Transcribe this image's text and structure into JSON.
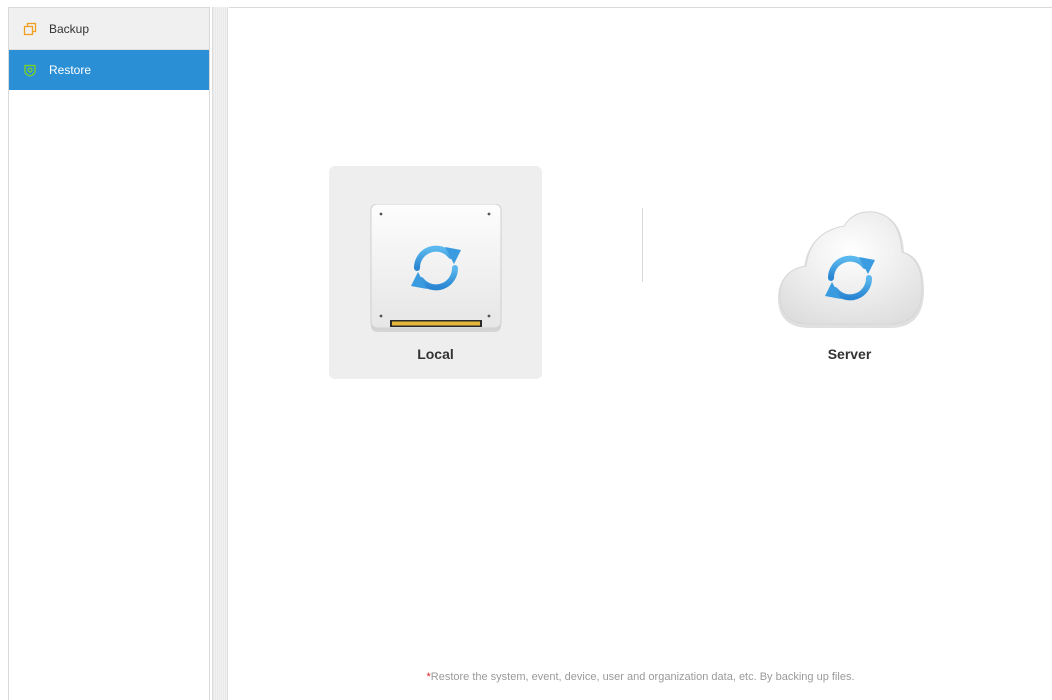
{
  "sidebar": {
    "items": [
      {
        "label": "Backup",
        "icon": "backup-icon",
        "icon_color": "#f0a020",
        "selected": false
      },
      {
        "label": "Restore",
        "icon": "restore-shield-icon",
        "icon_color": "#7ed321",
        "selected": true
      }
    ]
  },
  "main": {
    "options": [
      {
        "label": "Local",
        "icon": "local-drive-sync-icon",
        "selected": true
      },
      {
        "label": "Server",
        "icon": "cloud-sync-icon",
        "selected": false
      }
    ],
    "footnote": {
      "marker": "*",
      "text": "Restore the system, event, device, user and organization data, etc. By backing up files."
    }
  },
  "colors": {
    "accent": "#2b8fd6",
    "sync_arrows": "#3a9be0",
    "selected_option_bg": "#eeeeee",
    "required_marker": "#e02020"
  }
}
